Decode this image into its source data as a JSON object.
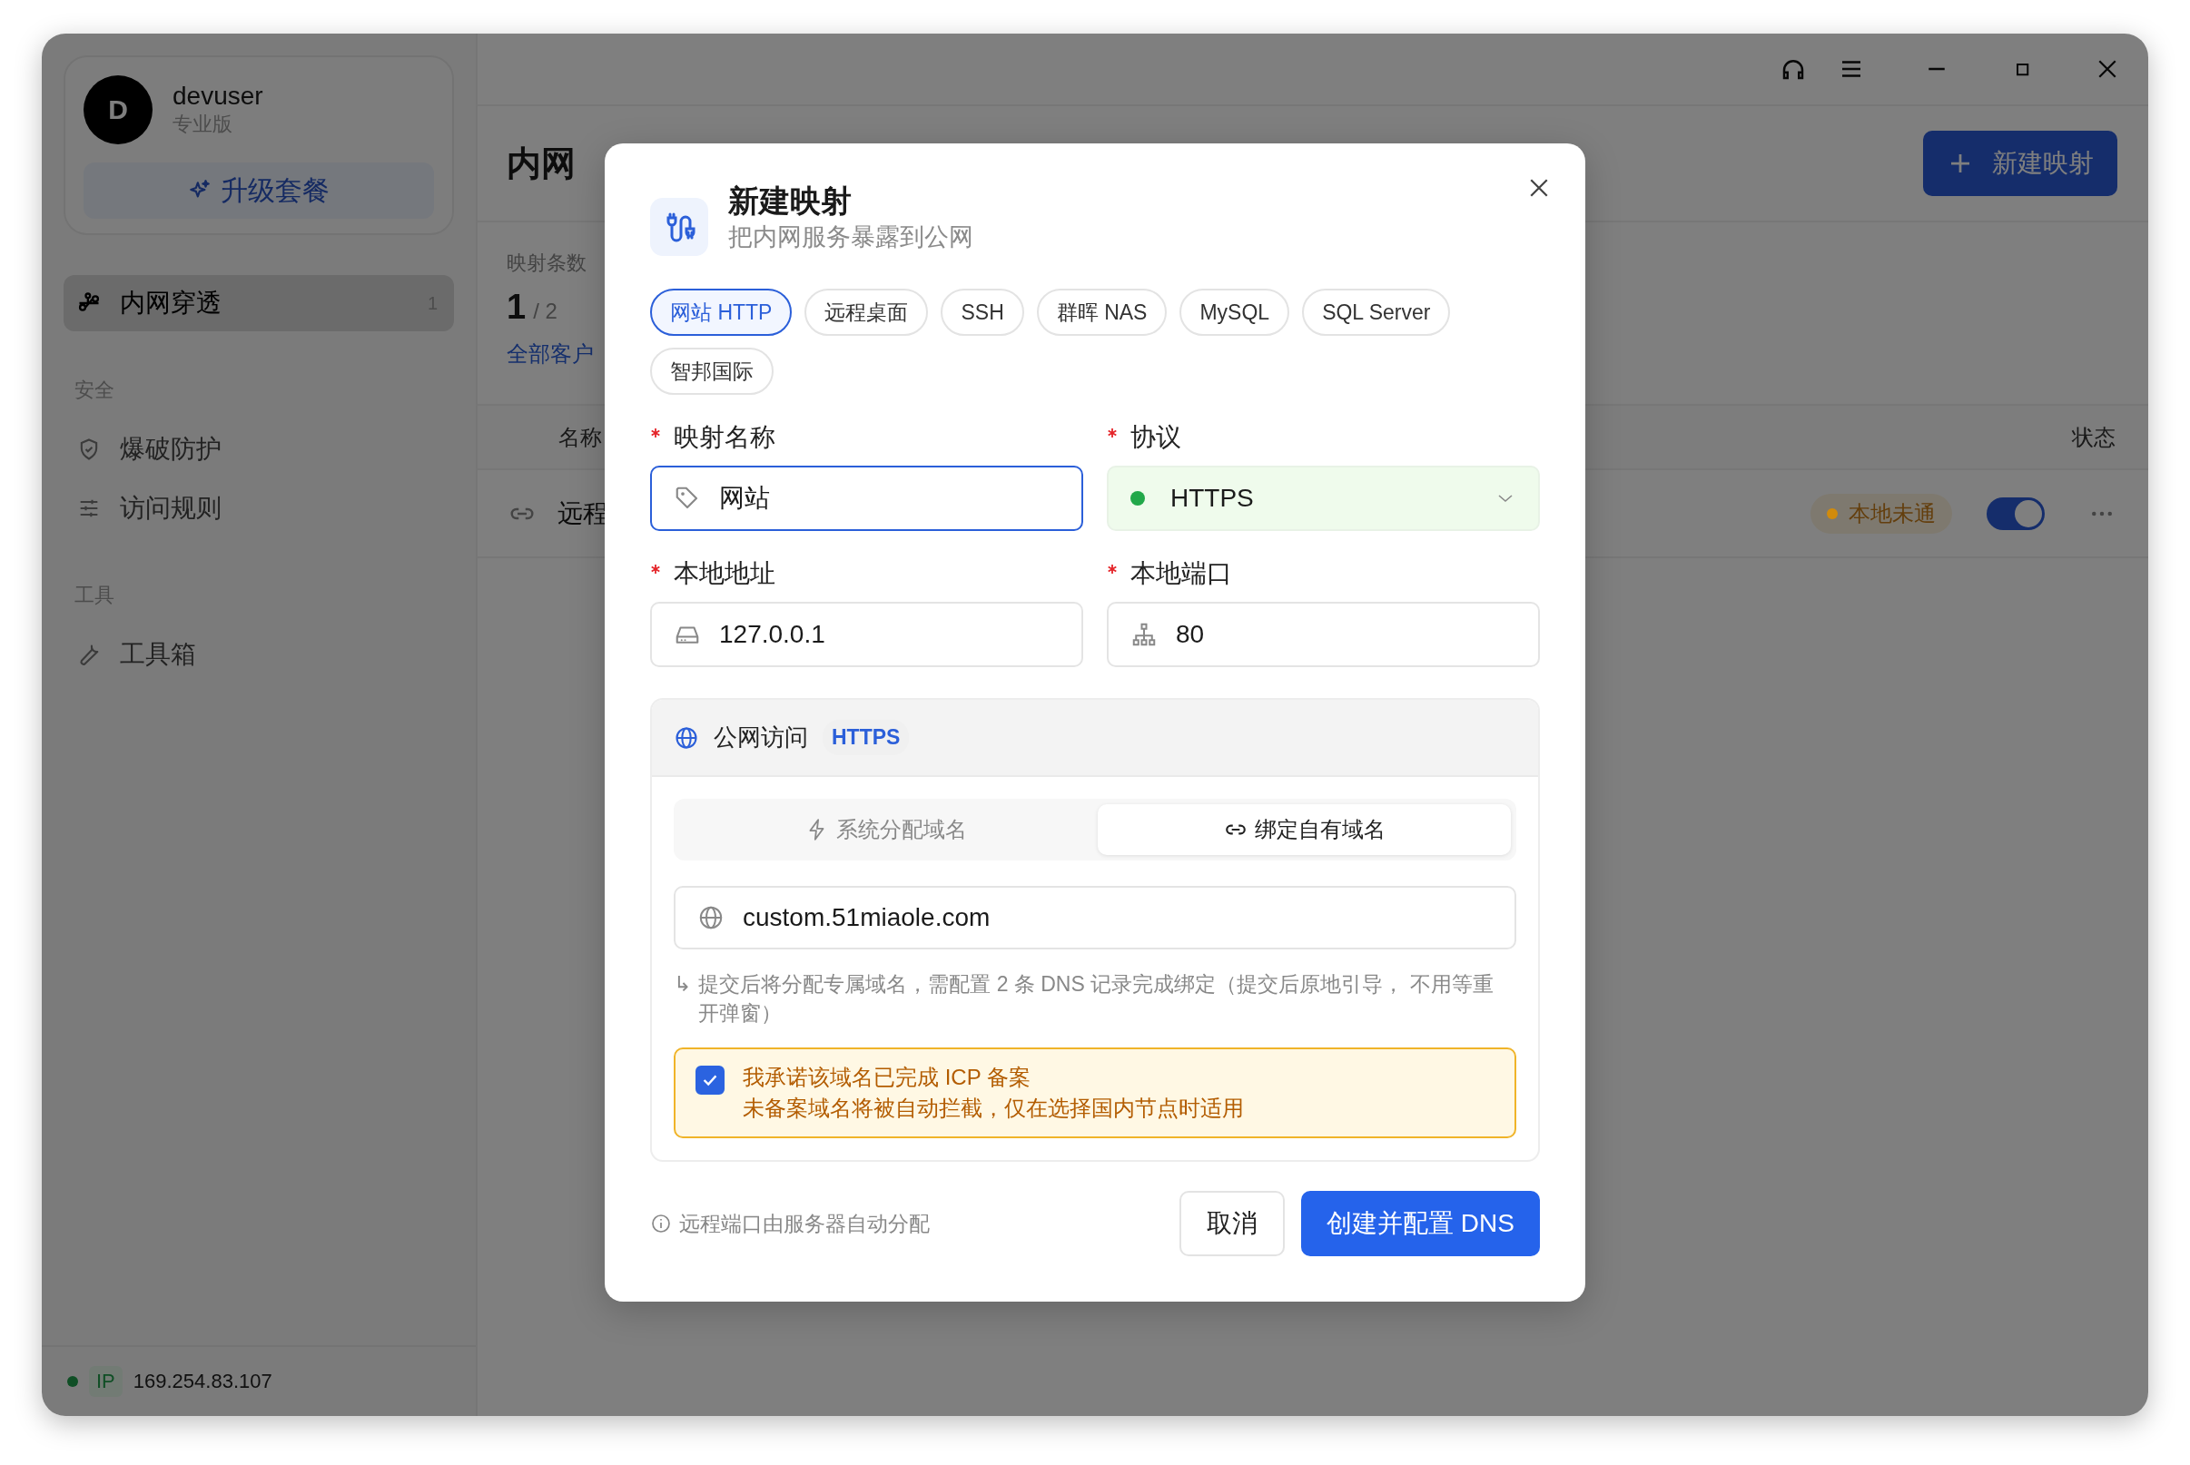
{
  "sidebar": {
    "user": {
      "initial": "D",
      "name": "devuser",
      "plan": "专业版"
    },
    "upgrade_button": "升级套餐",
    "nav": [
      {
        "label": "内网穿透",
        "count": "1",
        "selected": true
      }
    ],
    "sections": [
      {
        "title": "安全",
        "items": [
          {
            "label": "爆破防护",
            "selected": false
          },
          {
            "label": "访问规则",
            "selected": false
          }
        ]
      },
      {
        "title": "工具",
        "items": [
          {
            "label": "工具箱",
            "selected": false
          }
        ]
      }
    ],
    "status": {
      "online": true,
      "badge": "IP",
      "ip": "169.254.83.107"
    }
  },
  "main": {
    "title": "内网",
    "new_button": "新建映射",
    "stats": {
      "label": "映射条数",
      "used": "1",
      "total": "/ 2",
      "link": "全部客户"
    },
    "table": {
      "columns": [
        "名称",
        "状态"
      ],
      "rows": [
        {
          "name": "远程",
          "status": "本地未通",
          "color": "#d18b0c",
          "enabled": true
        }
      ]
    }
  },
  "dialog": {
    "title": "新建映射",
    "subtitle": "把内网服务暴露到公网",
    "presets": [
      {
        "label": "网站 HTTP",
        "selected": true
      },
      {
        "label": "远程桌面",
        "selected": false
      },
      {
        "label": "SSH",
        "selected": false
      },
      {
        "label": "群晖 NAS",
        "selected": false
      },
      {
        "label": "MySQL",
        "selected": false
      },
      {
        "label": "SQL Server",
        "selected": false
      },
      {
        "label": "智邦国际",
        "selected": false
      }
    ],
    "fields": [
      {
        "kind": "name",
        "label": "映射名称",
        "required": true,
        "value": "网站",
        "focused": true
      },
      {
        "kind": "select",
        "label": "协议",
        "required": true,
        "value": "HTTPS",
        "color": "#22a84a"
      },
      {
        "kind": "address",
        "label": "本地地址",
        "required": true,
        "value": "127.0.0.1",
        "focused": false
      },
      {
        "kind": "port",
        "label": "本地端口",
        "required": true,
        "value": "80",
        "focused": false
      }
    ],
    "public_access": {
      "title": "公网访问",
      "badge": "HTTPS",
      "modes": [
        {
          "label": "系统分配域名",
          "selected": false
        },
        {
          "label": "绑定自有域名",
          "selected": true
        }
      ],
      "domain": "custom.51miaole.com",
      "hint_mark": "↳",
      "hint": "提交后将分配专属域名，需配置 2 条 DNS 记录完成绑定（提交后原地引导， 不用等重开弹窗）",
      "icp": {
        "checked": true,
        "title": "我承诺该域名已完成 ICP 备案",
        "note": "未备案域名将被自动拦截，仅在选择国内节点时适用"
      }
    },
    "footer_note": "远程端口由服务器自动分配",
    "buttons": [
      {
        "kind": "secondary",
        "label": "取消"
      },
      {
        "kind": "primary",
        "label": "创建并配置 DNS"
      }
    ]
  }
}
